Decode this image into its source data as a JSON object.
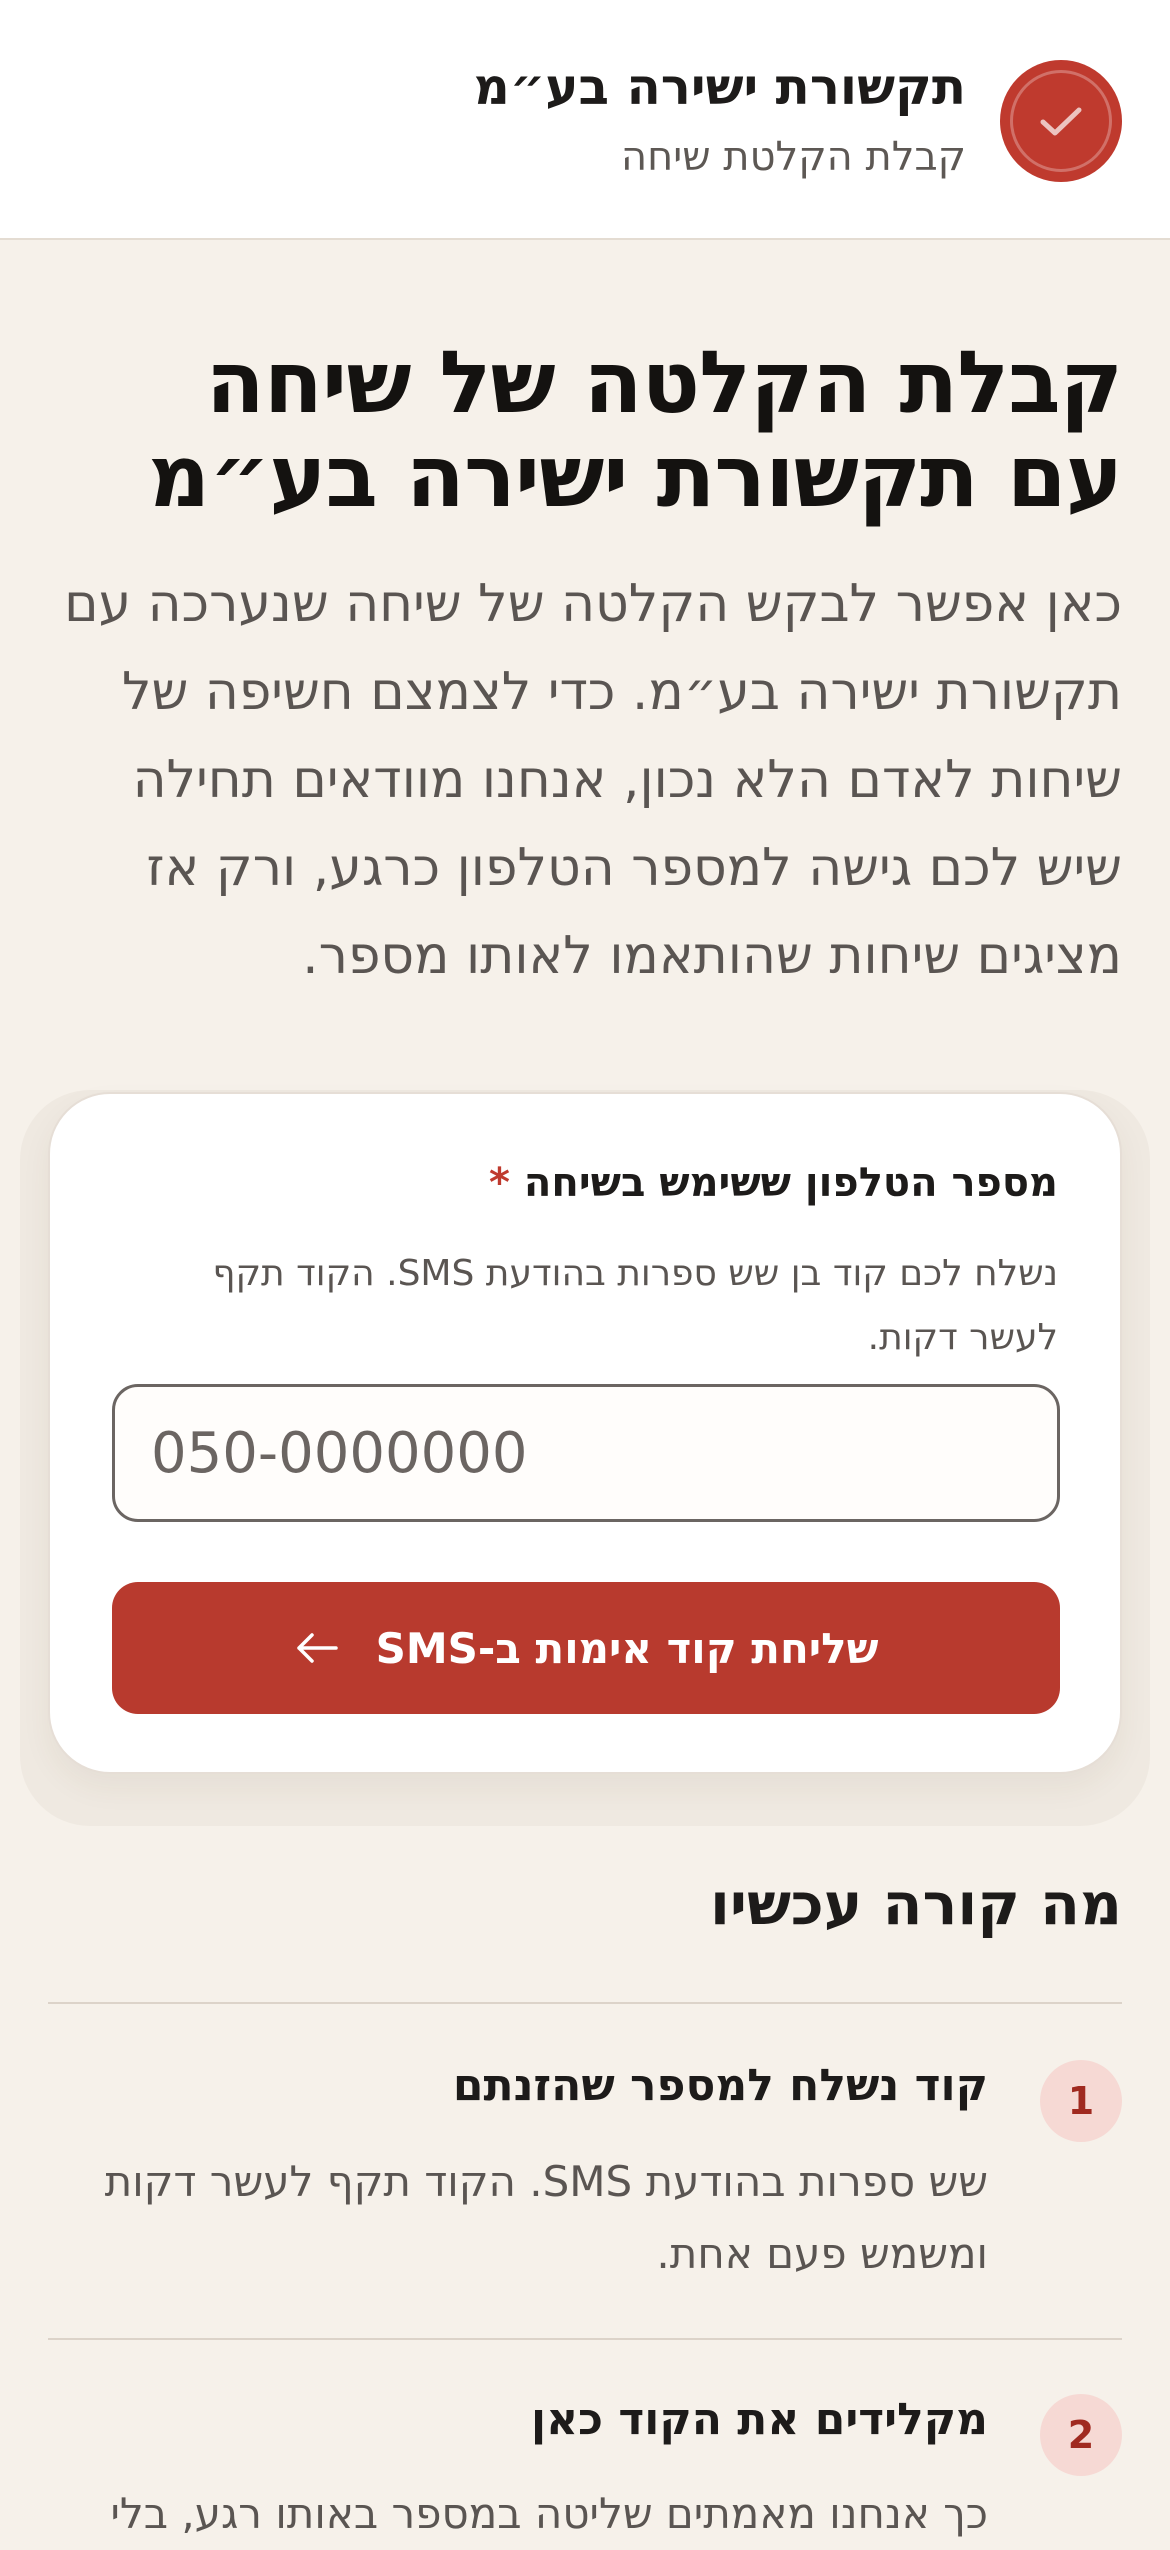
{
  "header": {
    "title": "תקשורת ישירה בע״מ",
    "subtitle": "קבלת הקלטת שיחה",
    "logo_icon": "check-icon",
    "accent_color": "#bf3a2e"
  },
  "hero": {
    "title_lines": [
      "קבלת הקלטה של שיחה",
      "עם תקשורת ישירה בע״מ"
    ],
    "body_lines": [
      "כאן אפשר לבקש הקלטה של שיחה שנערכה עם",
      "תקשורת ישירה בע״מ. כדי לצמצם חשיפה של",
      "שיחות לאדם הלא נכון, אנחנו מוודאים תחילה",
      "שיש לכם גישה למספר הטלפון כרגע, ורק אז",
      "מציגים שיחות שהותאמו לאותו מספר."
    ]
  },
  "form": {
    "label": "מספר הטלפון ששימש בשיחה",
    "required_mark": "*",
    "help_lines": [
      "נשלח לכם קוד בן שש ספרות בהודעת SMS. הקוד תקף",
      "לעשר דקות."
    ],
    "phone_value": "",
    "phone_placeholder": "050-0000000",
    "submit_label": "שליחת קוד אימות ב-SMS",
    "submit_icon": "arrow-left-icon"
  },
  "steps": {
    "title": "מה קורה עכשיו",
    "items": [
      {
        "number": "1",
        "title": "קוד נשלח למספר שהזנתם",
        "desc_lines": [
          "שש ספרות בהודעת SMS. הקוד תקף לעשר דקות",
          "ומשמש פעם אחת."
        ]
      },
      {
        "number": "2",
        "title": "מקלידים את הקוד כאן",
        "desc_lines": [
          "כך אנחנו מאמתים שליטה במספר באותו רגע, בלי"
        ]
      }
    ]
  }
}
